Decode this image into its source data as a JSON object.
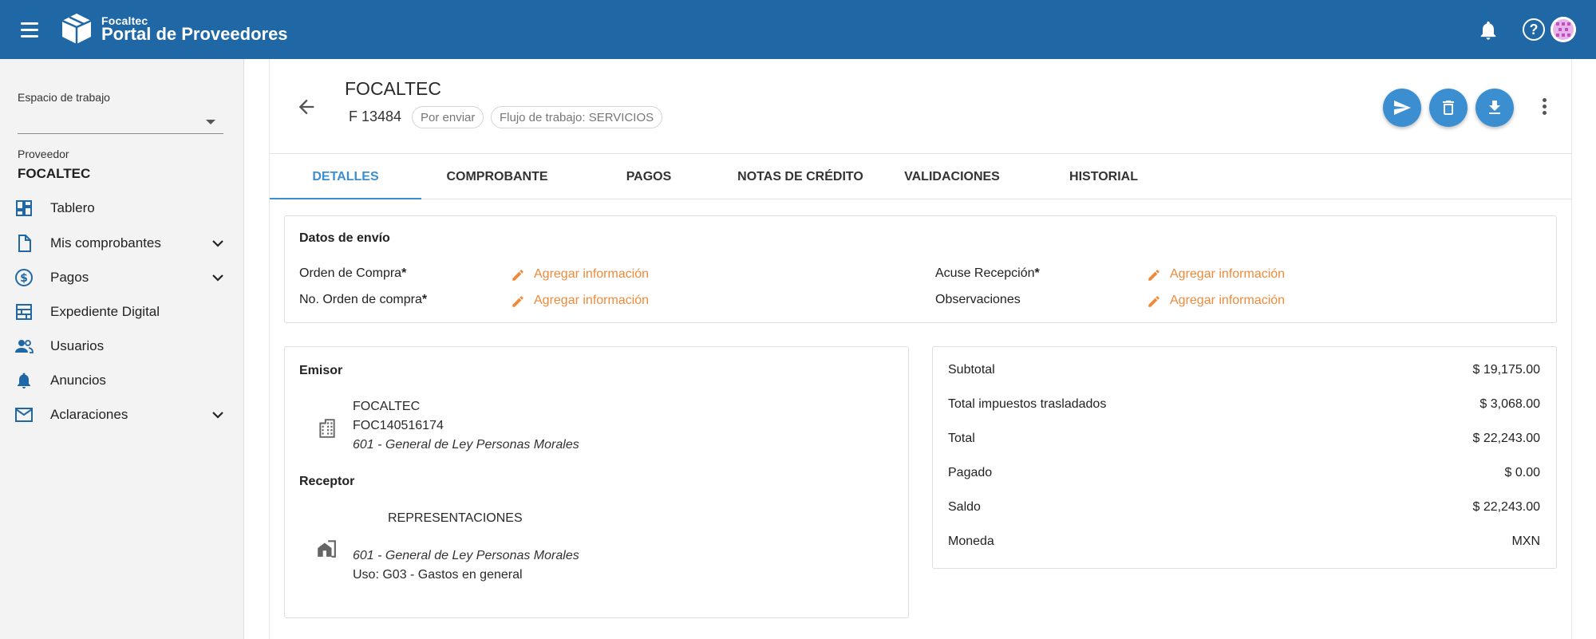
{
  "header": {
    "brand_small": "Focaltec",
    "brand_big": "Portal de Proveedores"
  },
  "sidebar": {
    "workspace_label": "Espacio de trabajo",
    "workspace_value": "",
    "provider_label": "Proveedor",
    "provider_name": "FOCALTEC",
    "items": [
      {
        "label": "Tablero",
        "icon": "dashboard-icon"
      },
      {
        "label": "Mis comprobantes",
        "icon": "document-icon",
        "expandable": true
      },
      {
        "label": "Pagos",
        "icon": "dollar-icon",
        "expandable": true
      },
      {
        "label": "Expediente Digital",
        "icon": "digital-file-icon"
      },
      {
        "label": "Usuarios",
        "icon": "users-icon"
      },
      {
        "label": "Anuncios",
        "icon": "bell-icon"
      },
      {
        "label": "Aclaraciones",
        "icon": "mail-icon",
        "expandable": true
      }
    ]
  },
  "document": {
    "title": "FOCALTEC",
    "number": "F 13484",
    "status_chip": "Por enviar",
    "workflow_chip": "Flujo de trabajo: SERVICIOS"
  },
  "tabs": [
    "DETALLES",
    "COMPROBANTE",
    "PAGOS",
    "NOTAS DE CRÉDITO",
    "VALIDACIONES",
    "HISTORIAL"
  ],
  "shipping": {
    "title": "Datos de envío",
    "orden_compra": "Orden de Compra",
    "no_orden_compra": "No. Orden de compra",
    "acuse_recepcion": "Acuse Recepción",
    "observaciones": "Observaciones",
    "required_mark": "*",
    "add_info": "Agregar información"
  },
  "emisor": {
    "title": "Emisor",
    "name": "FOCALTEC",
    "rfc": "FOC140516174",
    "regimen": "601 - General de Ley Personas Morales"
  },
  "receptor": {
    "title": "Receptor",
    "name": "REPRESENTACIONES",
    "regimen": "601 - General de Ley Personas Morales",
    "uso": "Uso: G03 - Gastos en general"
  },
  "summary": {
    "rows": [
      {
        "label": "Subtotal",
        "value": "$ 19,175.00"
      },
      {
        "label": "Total impuestos trasladados",
        "value": "$ 3,068.00"
      },
      {
        "label": "Total",
        "value": "$ 22,243.00"
      },
      {
        "label": "Pagado",
        "value": "$ 0.00"
      },
      {
        "label": "Saldo",
        "value": "$ 22,243.00"
      },
      {
        "label": "Moneda",
        "value": "MXN"
      }
    ]
  },
  "colors": {
    "topbar": "#1f68a5",
    "accent": "#3b8fd0",
    "link_orange": "#ef8a3a"
  }
}
